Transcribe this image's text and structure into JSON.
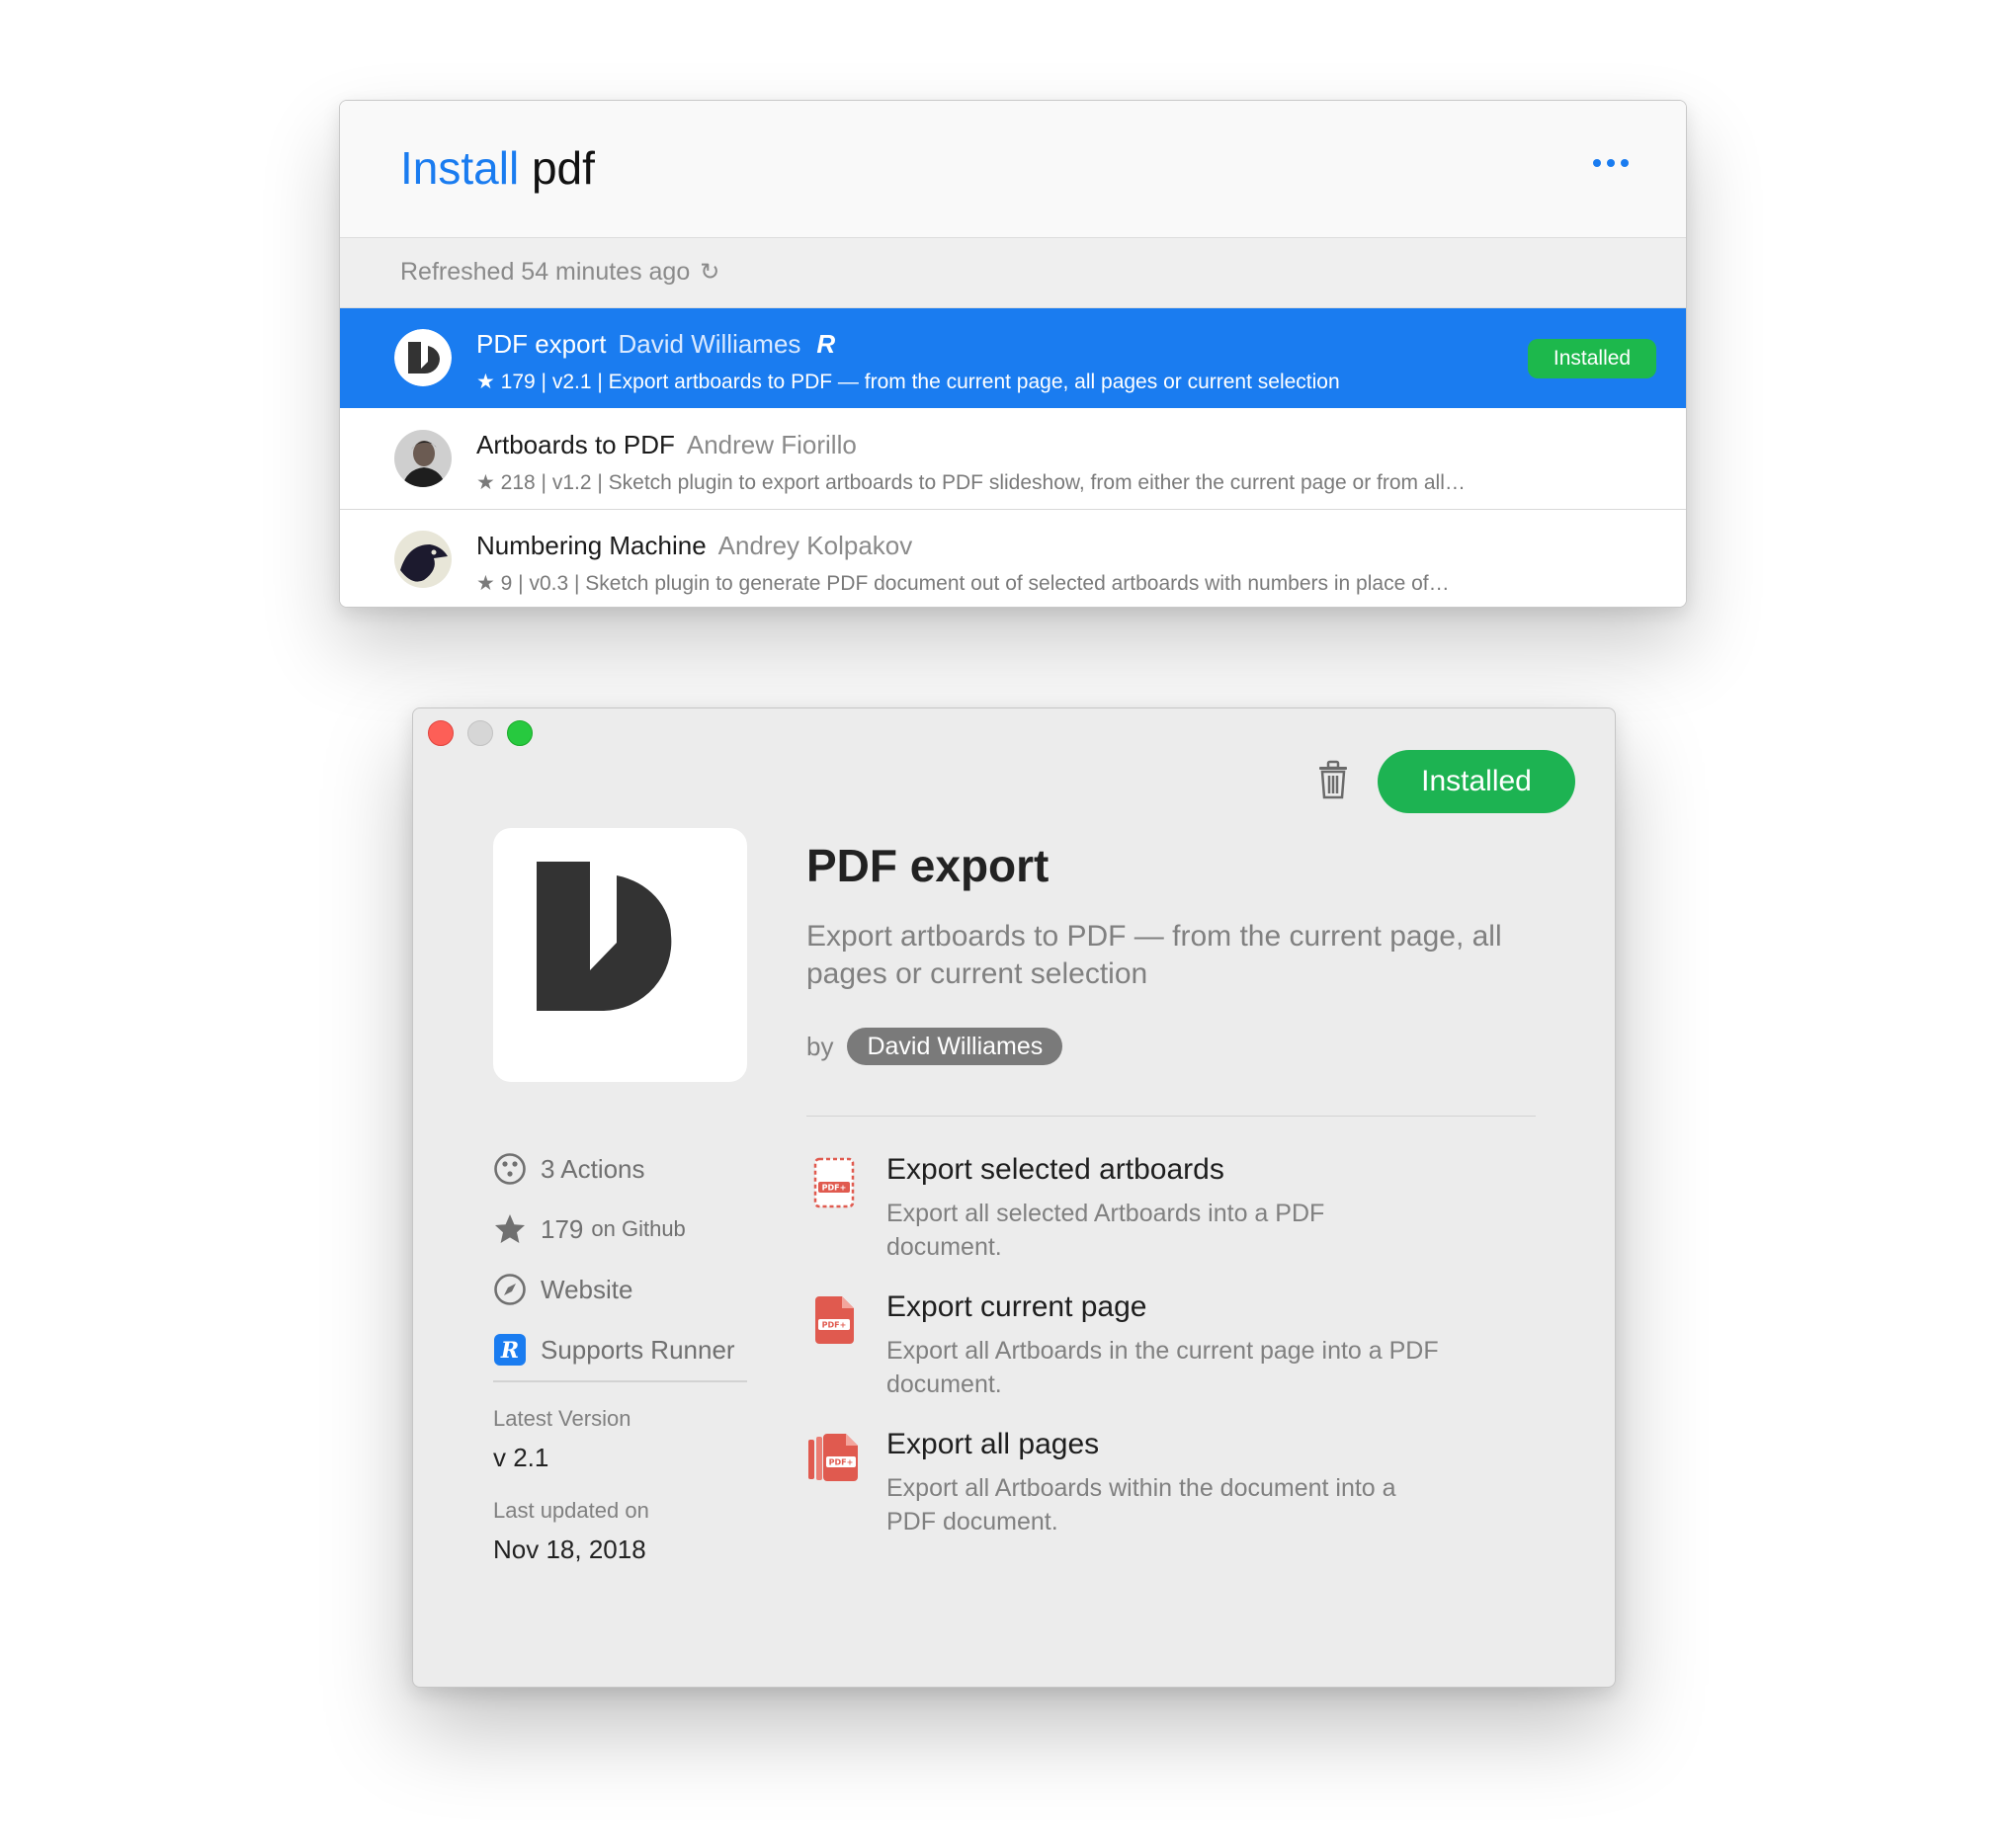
{
  "search": {
    "title_keyword": "Install",
    "title_query": "pdf",
    "refreshed": "Refreshed 54 minutes ago",
    "refresh_icon": "↻",
    "results": [
      {
        "name": "PDF export",
        "author": "David Williames",
        "meta": "★ 179 | v2.1 | Export artboards to PDF — from the current page, all pages or current selection",
        "badge": "Installed",
        "runner_badge": "R"
      },
      {
        "name": "Artboards to PDF",
        "author": "Andrew Fiorillo",
        "meta": "★ 218 | v1.2 | Sketch plugin to export artboards to PDF slideshow, from either the current page or from all…"
      },
      {
        "name": "Numbering Machine",
        "author": "Andrey Kolpakov",
        "meta": "★ 9 | v0.3 | Sketch plugin to generate PDF document out of selected artboards with numbers in place of…"
      }
    ]
  },
  "detail": {
    "status_button": "Installed",
    "title": "PDF export",
    "description": "Export artboards to PDF — from the current page, all pages or current selection",
    "by_label": "by",
    "author": "David Williames",
    "actions": [
      {
        "title": "Export selected artboards",
        "desc": "Export all selected Artboards into a PDF document."
      },
      {
        "title": "Export current page",
        "desc": "Export all Artboards in the current page into a PDF document."
      },
      {
        "title": "Export all pages",
        "desc": "Export all Artboards within the document into a PDF document."
      }
    ],
    "sidebar": {
      "actions_count": "3 Actions",
      "stars": "179",
      "stars_suffix": "on Github",
      "website": "Website",
      "runner": "Supports Runner",
      "latest_version_label": "Latest Version",
      "latest_version": "v 2.1",
      "last_updated_label": "Last updated on",
      "last_updated": "Nov 18, 2018"
    },
    "pdf_icon_label": "PDF+",
    "runner_icon_label": "R"
  },
  "colors": {
    "accent": "#1a7cf0",
    "installed_green": "#1db352",
    "pdf_red": "#e05a4f"
  }
}
